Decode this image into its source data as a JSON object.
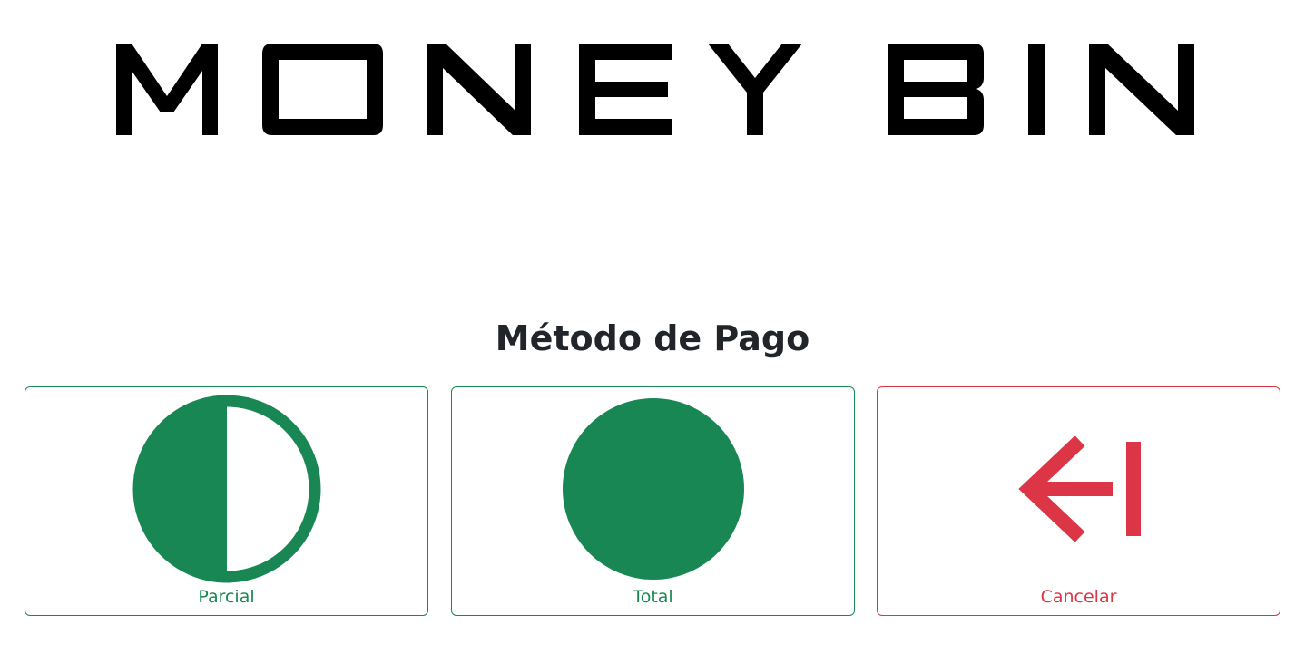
{
  "logo": {
    "text": "MONEY BIN"
  },
  "page_title": "Método de Pago",
  "options": [
    {
      "label": "Parcial",
      "icon": "half-circle-icon",
      "color": "#198754"
    },
    {
      "label": "Total",
      "icon": "full-circle-icon",
      "color": "#198754"
    },
    {
      "label": "Cancelar",
      "icon": "arrow-left-bar-icon",
      "color": "#dc3545"
    }
  ]
}
